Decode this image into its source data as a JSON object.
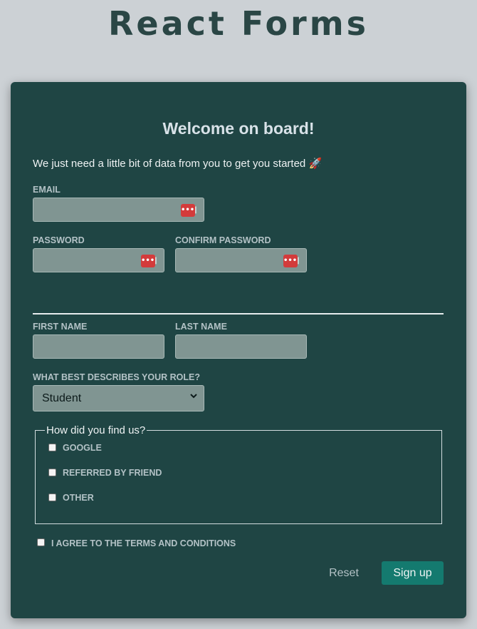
{
  "app_title": "React Forms",
  "form": {
    "heading": "Welcome on board!",
    "intro": "We just need a little bit of data from you to get you started",
    "intro_emoji": "🚀",
    "email": {
      "label": "EMAIL",
      "value": ""
    },
    "password": {
      "label": "PASSWORD",
      "value": ""
    },
    "confirm_password": {
      "label": "CONFIRM PASSWORD",
      "value": ""
    },
    "password_manager_glyph": "•••|",
    "first_name": {
      "label": "FIRST NAME",
      "value": ""
    },
    "last_name": {
      "label": "LAST NAME",
      "value": ""
    },
    "role": {
      "label": "WHAT BEST DESCRIBES YOUR ROLE?",
      "selected": "Student"
    },
    "source": {
      "legend": "How did you find us?",
      "options": [
        "GOOGLE",
        "REFERRED BY FRIEND",
        "OTHER"
      ]
    },
    "terms_label": "I AGREE TO THE TERMS AND CONDITIONS",
    "reset_label": "Reset",
    "signup_label": "Sign up"
  },
  "colors": {
    "page_bg": "#ccd1d5",
    "card_bg": "#1f4544",
    "input_bg": "#809592",
    "primary_button": "#147a6f",
    "label_text": "#b3c2c6"
  }
}
